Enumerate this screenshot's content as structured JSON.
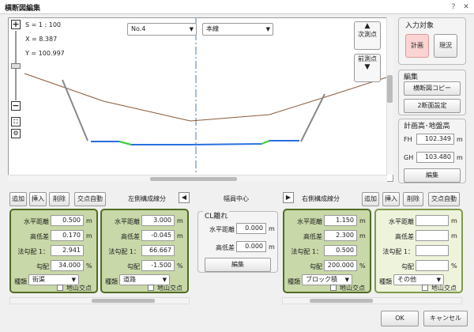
{
  "window": {
    "title": "横断図編集",
    "help": "?",
    "close": "✕"
  },
  "canvas": {
    "scale": "S = 1 : 100",
    "x": "X = 8.387",
    "y": "Y = 100.997",
    "station": "No.4",
    "line": "本線",
    "next_btn": "次測点",
    "prev_btn": "前測点"
  },
  "right": {
    "input_title": "入力対象",
    "plan": "計画",
    "current": "現況",
    "edit_title": "編集",
    "copy_btn": "横断図コピー",
    "two_btn": "2断面設定",
    "height_title": "計画高･地盤高",
    "fh_label": "FH",
    "fh": "102.349",
    "gh_label": "GH",
    "gh": "103.480",
    "unit": "m",
    "edit_btn": "編集"
  },
  "toolbar": {
    "add": "追加",
    "insert": "挿入",
    "delete": "削除",
    "auto": "交点自動",
    "left_label": "左側構成線分",
    "center": "幅員中心",
    "right_label": "右側構成線分"
  },
  "labels": {
    "hdist": "水平距離",
    "hdiff": "高低差",
    "slope": "法勾配 1：",
    "grade": "勾配",
    "kind": "種類",
    "ground": "地山交点",
    "m": "m",
    "pct": "%"
  },
  "panels": [
    {
      "hdist": "0.500",
      "hdiff": "0.170",
      "slope": "2.941",
      "grade": "34.000",
      "kind": "街渠"
    },
    {
      "hdist": "3.000",
      "hdiff": "-0.045",
      "slope": "66.667",
      "grade": "-1.500",
      "kind": "道路"
    },
    {
      "hdist": "1.150",
      "hdiff": "2.300",
      "slope": "0.500",
      "grade": "200.000",
      "kind": "ブロック積"
    },
    {
      "hdist": "",
      "hdiff": "",
      "slope": "",
      "grade": "",
      "kind": "その他"
    }
  ],
  "cl": {
    "title": "CL離れ",
    "hdist_label": "水平距離",
    "hdist": "0.000",
    "hdiff_label": "高低差",
    "hdiff": "0.000",
    "edit": "編集"
  },
  "footer": {
    "ok": "OK",
    "cancel": "キャンセル"
  }
}
